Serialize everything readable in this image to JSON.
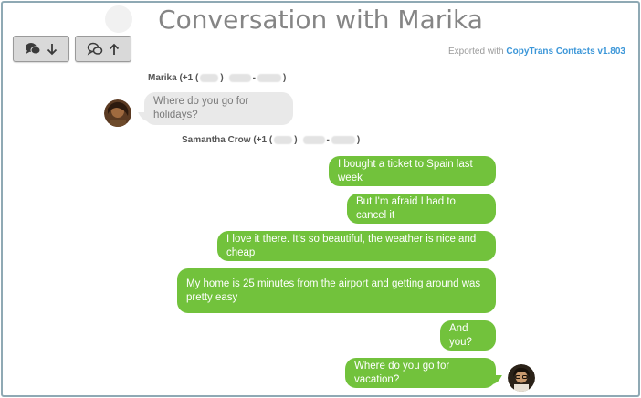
{
  "header": {
    "title": "Conversation with Marika",
    "exported_prefix": "Exported with ",
    "exported_brand": "CopyTrans Contacts v1.803"
  },
  "toolbar": {
    "scroll_down_icon": "chat-bubbles-arrow-down-icon",
    "scroll_up_icon": "chat-bubbles-arrow-up-icon"
  },
  "messages": {
    "sender_marika": "Marika (+1 (",
    "sender_samantha": "Samantha Crow (+1 (",
    "paren_close": ")",
    "dash": "-",
    "m1": "Where do you go for holidays?",
    "m2": "I bought a ticket to Spain last week",
    "m3": "But I'm afraid I had to cancel it",
    "m4": "I love it there. It's so beautiful, the weather is nice and cheap",
    "m5": "My home is 25 minutes from the airport and getting around was pretty easy",
    "m6": "And you?",
    "m7": "Where do you go for vacation?"
  },
  "colors": {
    "outgoing_bubble": "#72c23c",
    "incoming_bubble": "#e9e9e9",
    "brand_link": "#3b96d8"
  }
}
